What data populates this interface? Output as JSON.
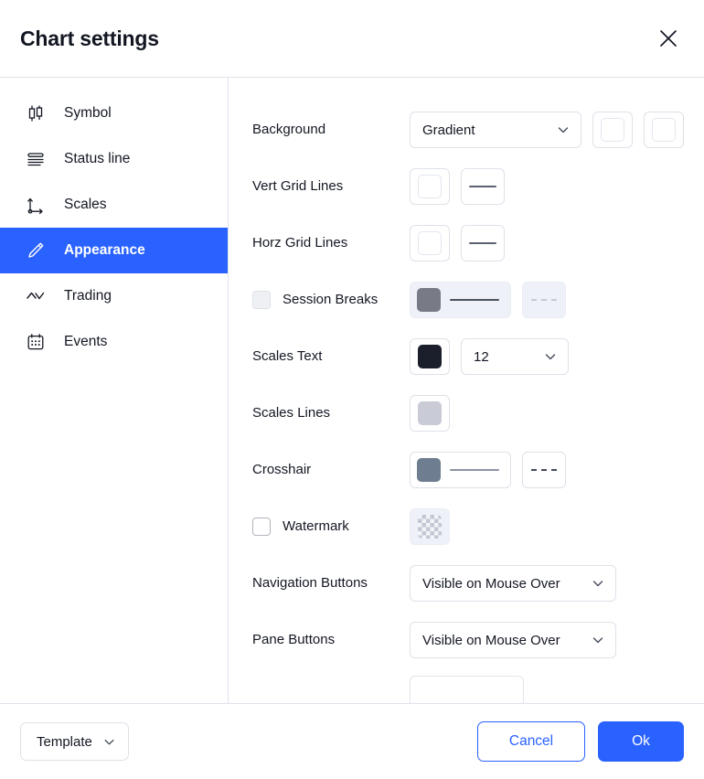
{
  "header": {
    "title": "Chart settings",
    "close_icon": "close-icon"
  },
  "sidebar": {
    "items": [
      {
        "label": "Symbol",
        "icon": "candlestick-icon",
        "active": false
      },
      {
        "label": "Status line",
        "icon": "status-line-icon",
        "active": false
      },
      {
        "label": "Scales",
        "icon": "axes-icon",
        "active": false
      },
      {
        "label": "Appearance",
        "icon": "pencil-icon",
        "active": true
      },
      {
        "label": "Trading",
        "icon": "zigzag-icon",
        "active": false
      },
      {
        "label": "Events",
        "icon": "calendar-icon",
        "active": false
      }
    ]
  },
  "settings": {
    "background": {
      "label": "Background",
      "mode_value": "Gradient",
      "color_1": "#ffffff",
      "color_2": "#ffffff"
    },
    "vert_grid_lines": {
      "label": "Vert Grid Lines",
      "color": "#ffffff",
      "line_style": "solid"
    },
    "horz_grid_lines": {
      "label": "Horz Grid Lines",
      "color": "#ffffff",
      "line_style": "solid"
    },
    "session_breaks": {
      "label": "Session Breaks",
      "checked": false,
      "disabled": true,
      "color": "#787b86",
      "line_style": "solid",
      "dash_style": "dashed"
    },
    "scales_text": {
      "label": "Scales Text",
      "color": "#1b1f2b",
      "font_size": "12"
    },
    "scales_lines": {
      "label": "Scales Lines",
      "color": "#c9ccd6"
    },
    "crosshair": {
      "label": "Crosshair",
      "color": "#6e7d8f",
      "line_style": "solid",
      "dash_style": "dashed"
    },
    "watermark": {
      "label": "Watermark",
      "checked": false,
      "color": "transparent"
    },
    "navigation_buttons": {
      "label": "Navigation Buttons",
      "value": "Visible on Mouse Over"
    },
    "pane_buttons": {
      "label": "Pane Buttons",
      "value": "Visible on Mouse Over"
    }
  },
  "footer": {
    "template_label": "Template",
    "cancel_label": "Cancel",
    "ok_label": "Ok"
  },
  "colors": {
    "accent": "#2962ff",
    "text": "#131722",
    "border": "#e0e3eb"
  }
}
